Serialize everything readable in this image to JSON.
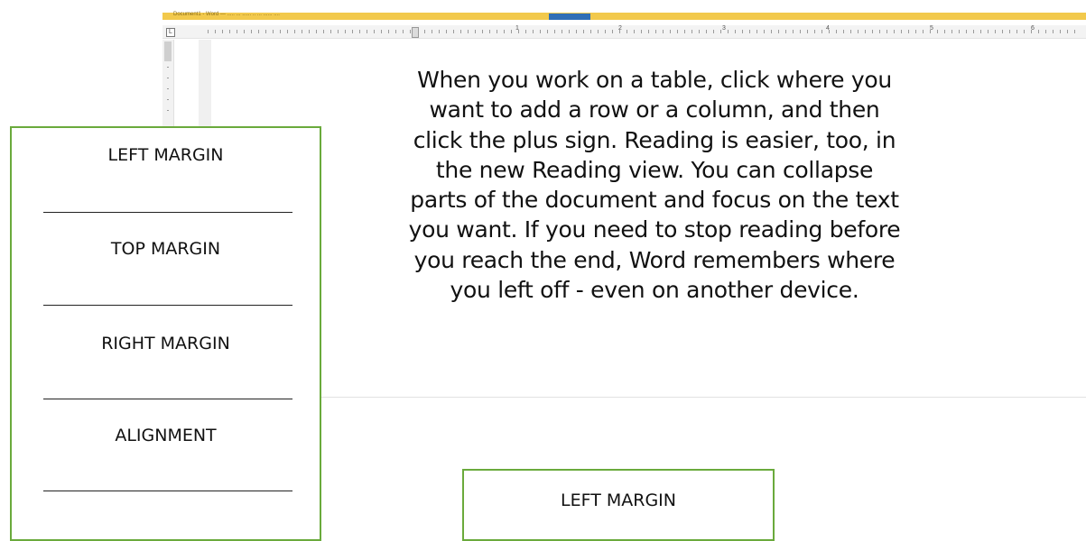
{
  "word_window": {
    "title_text": "Document1 - Word  —  ..... ...  ...... .. ... ...... ....",
    "ruler_numbers": [
      "1",
      "2",
      "3",
      "4",
      "5",
      "6"
    ],
    "ruler_corner_glyph": "L",
    "body_text": "When you work on a table, click where you want to add a row or a column, and then click the plus sign. Reading is easier, too, in the new Reading view. You can collapse parts of the document and focus on the text you want. If you need to stop reading before you reach the end, Word remembers where you left off - even on another device.",
    "colors": {
      "title_strip": "#f2c94c",
      "title_tab": "#2f6fb6"
    }
  },
  "answer_box": {
    "fields": [
      "LEFT MARGIN",
      "TOP MARGIN",
      "RIGHT MARGIN",
      "ALIGNMENT"
    ],
    "border_color": "#6aaa3c"
  },
  "answer_box_2": {
    "fields": [
      "LEFT MARGIN"
    ]
  }
}
